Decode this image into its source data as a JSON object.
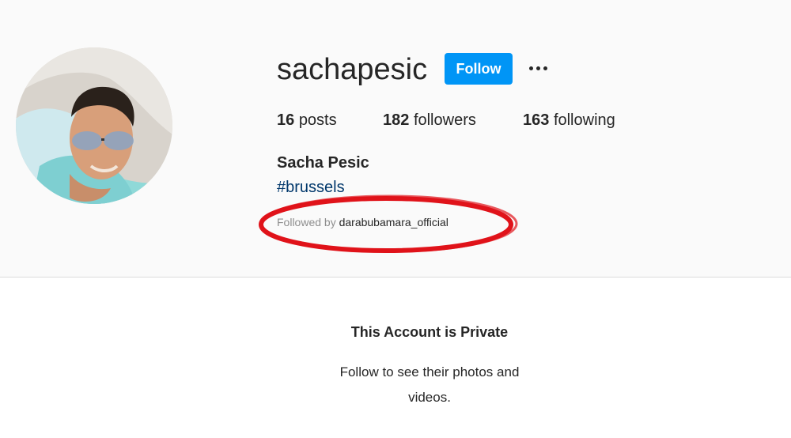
{
  "profile": {
    "username": "sachapesic",
    "follow_label": "Follow",
    "more_icon": "more-options-icon",
    "stats": {
      "posts_count": "16",
      "posts_label": "posts",
      "followers_count": "182",
      "followers_label": "followers",
      "following_count": "163",
      "following_label": "following"
    },
    "full_name": "Sacha Pesic",
    "bio_hashtag": "#brussels",
    "followed_by_label": "Followed by",
    "followed_by_user": "darabubamara_official"
  },
  "private": {
    "title": "This Account is Private",
    "message_line1": "Follow to see their photos and",
    "message_line2": "videos."
  },
  "colors": {
    "accent": "#0095f6",
    "hashtag": "#00376b",
    "annotation": "#e0131a",
    "header_bg": "#fafafa"
  }
}
